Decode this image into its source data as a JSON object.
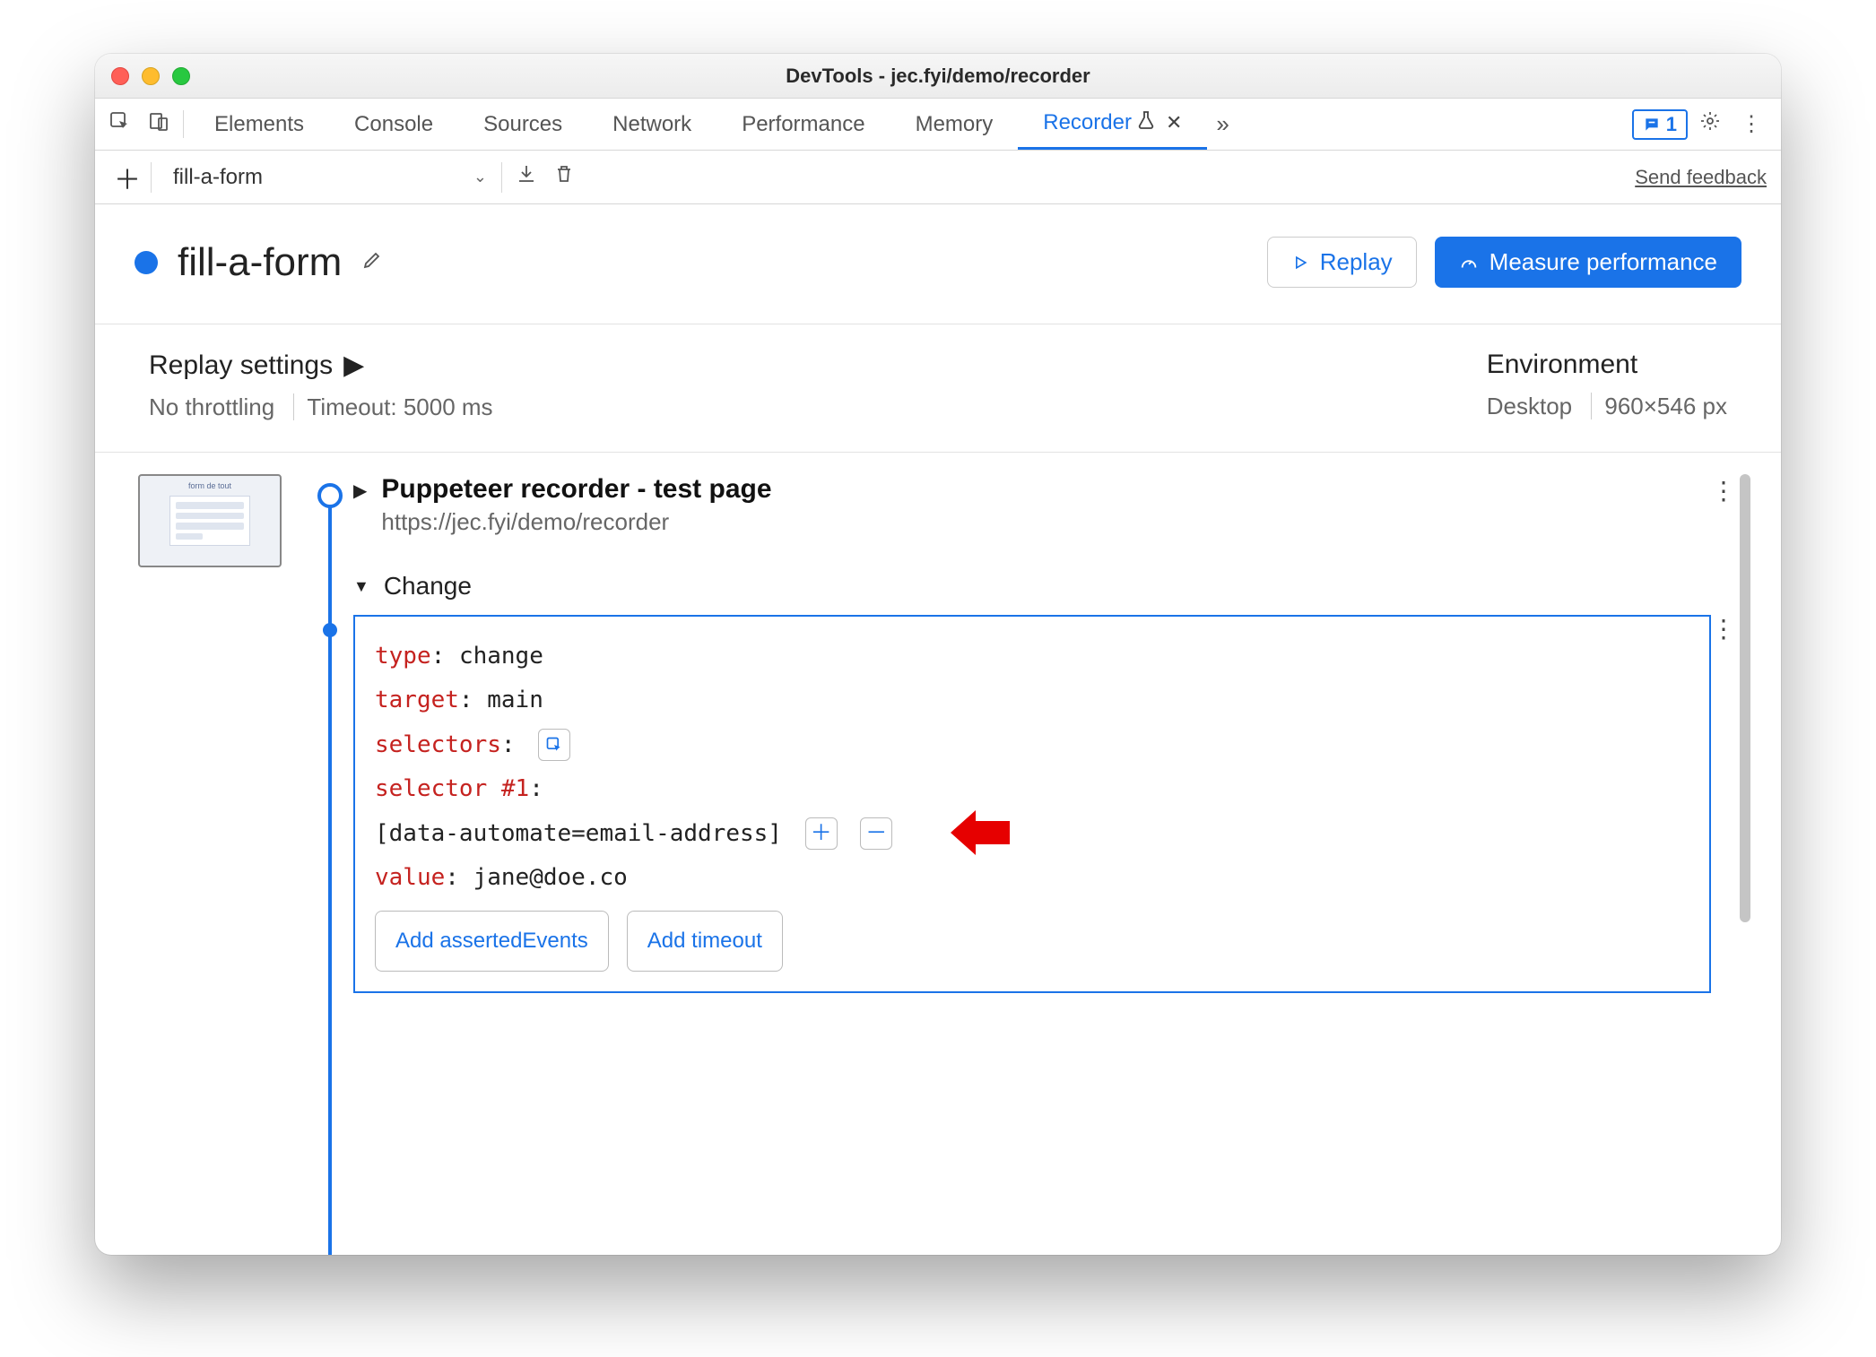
{
  "window": {
    "title": "DevTools - jec.fyi/demo/recorder"
  },
  "tabs": {
    "items": [
      "Elements",
      "Console",
      "Sources",
      "Network",
      "Performance",
      "Memory",
      "Recorder"
    ],
    "active": "Recorder",
    "badge_count": "1"
  },
  "toolbar": {
    "recording_name": "fill-a-form",
    "send_feedback": "Send feedback"
  },
  "header": {
    "recording_title": "fill-a-form",
    "replay_label": "Replay",
    "measure_label": "Measure performance"
  },
  "settings": {
    "replay_heading": "Replay settings",
    "throttling": "No throttling",
    "timeout": "Timeout: 5000 ms",
    "environment_heading": "Environment",
    "device": "Desktop",
    "viewport": "960×546 px"
  },
  "steps": {
    "initial": {
      "title": "Puppeteer recorder - test page",
      "url": "https://jec.fyi/demo/recorder"
    },
    "change": {
      "label": "Change",
      "type_key": "type",
      "type_val": "change",
      "target_key": "target",
      "target_val": "main",
      "selectors_key": "selectors",
      "selector_label": "selector #1",
      "selector_value": "[data-automate=email-address]",
      "value_key": "value",
      "value_val": "jane@doe.co",
      "add_asserted_label": "Add assertedEvents",
      "add_timeout_label": "Add timeout"
    }
  }
}
